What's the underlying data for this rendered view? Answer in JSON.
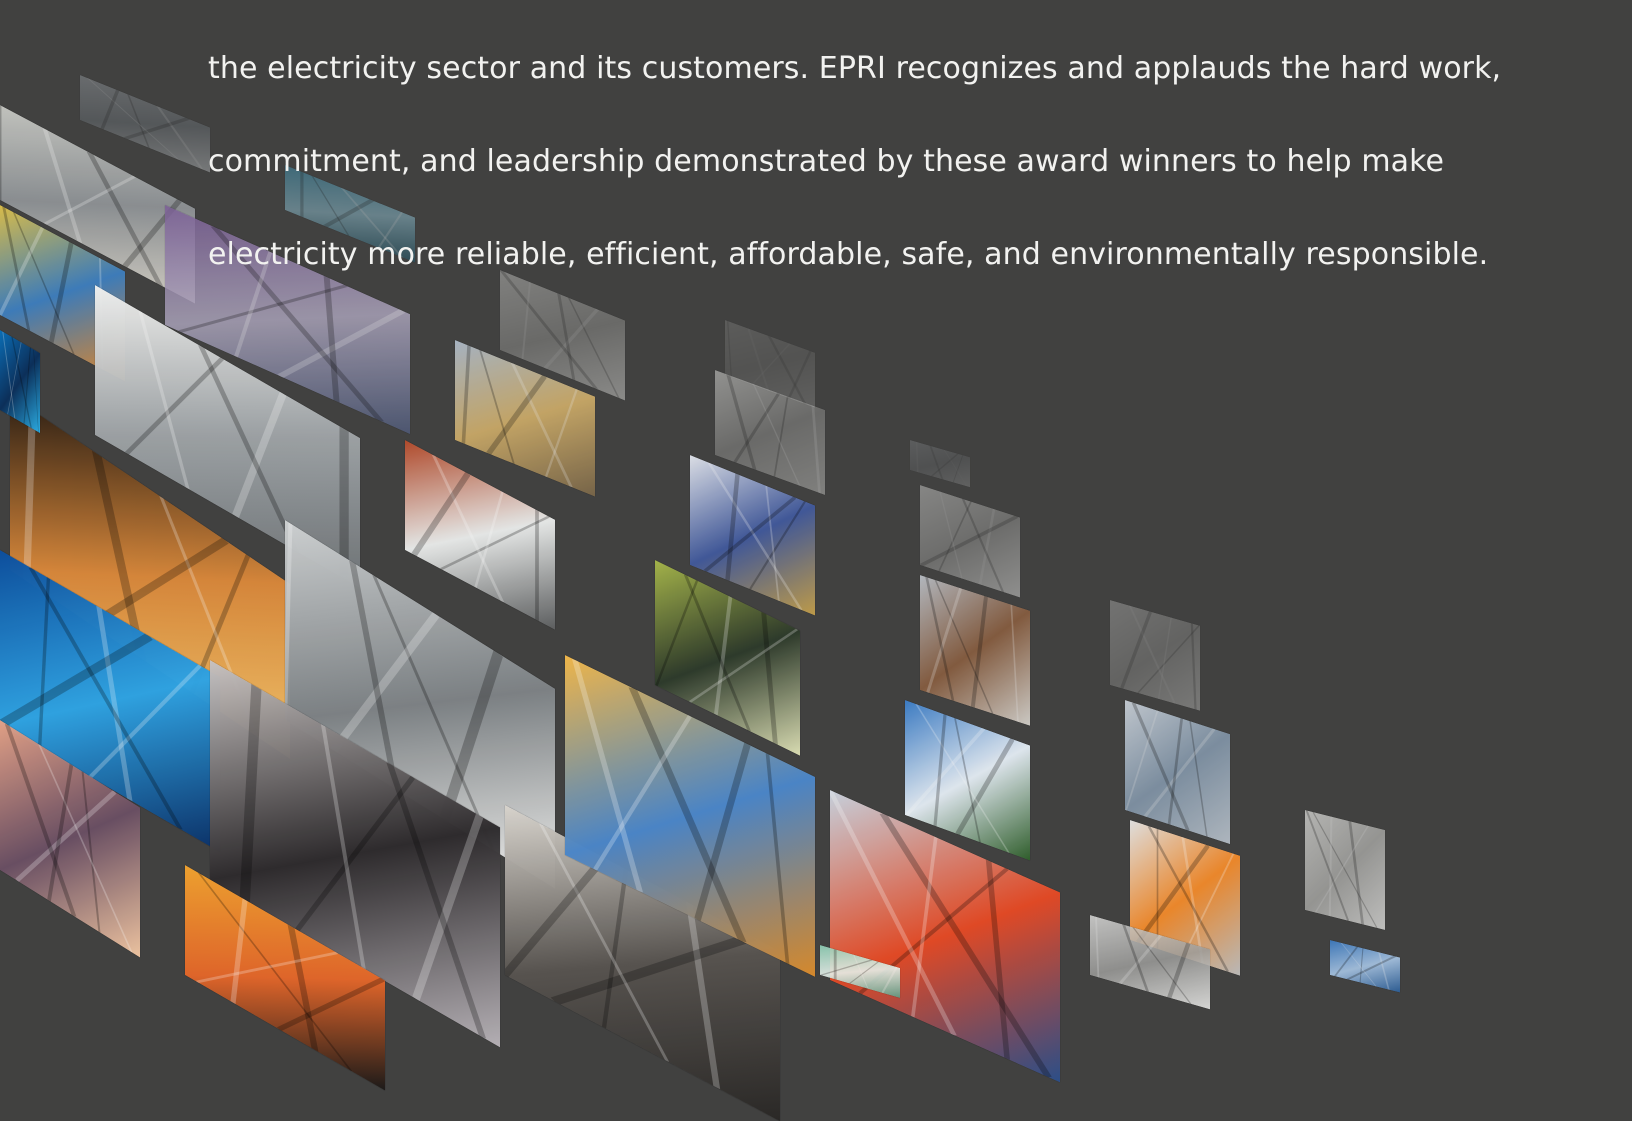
{
  "intro_text": {
    "line_1": "the electricity sector and its customers. EPRI recognizes and applauds the hard work,",
    "line_2": "commitment, and leadership demonstrated by these award winners to help make",
    "line_3": "electricity more reliable, efficient, affordable, safe, and environmentally responsible."
  },
  "colors": {
    "background": "#414140",
    "text": "#f2f2f0"
  },
  "photo_tiles": [
    {
      "subject": "control-room-operator",
      "icon": "control-room-photo"
    },
    {
      "subject": "wind-turbine-faded",
      "icon": "wind-turbine-photo"
    },
    {
      "subject": "substation-purple",
      "icon": "substation-photo"
    },
    {
      "subject": "worker-blue-equipment",
      "icon": "worker-photo"
    },
    {
      "subject": "turbine-machinery-gray",
      "icon": "machinery-photo"
    },
    {
      "subject": "solar-panels-sunset",
      "icon": "solar-panel-photo"
    },
    {
      "subject": "cybersecurity-lock",
      "icon": "lock-photo"
    },
    {
      "subject": "lineworkers-pole",
      "icon": "lineworker-photo"
    },
    {
      "subject": "smart-meter",
      "icon": "meter-photo"
    },
    {
      "subject": "steam-turbine-rotor",
      "icon": "turbine-photo"
    },
    {
      "subject": "ev-charging-plug",
      "icon": "ev-charger-photo"
    },
    {
      "subject": "transmission-tower-orange",
      "icon": "tower-photo"
    },
    {
      "subject": "nuclear-containment-vessel",
      "icon": "vessel-photo"
    },
    {
      "subject": "transmission-towers-sunset",
      "icon": "tower-photo"
    },
    {
      "subject": "dome-plant",
      "icon": "plant-photo"
    },
    {
      "subject": "hardhat-worker",
      "icon": "worker-photo"
    },
    {
      "subject": "pipe-inspection",
      "icon": "pipe-photo"
    },
    {
      "subject": "wind-turbines-sky",
      "icon": "wind-turbine-photo"
    },
    {
      "subject": "lineman-red-hardhat",
      "icon": "worker-photo"
    },
    {
      "subject": "utility-workers-vests",
      "icon": "worker-photo"
    },
    {
      "subject": "substation-structure",
      "icon": "substation-photo"
    }
  ]
}
